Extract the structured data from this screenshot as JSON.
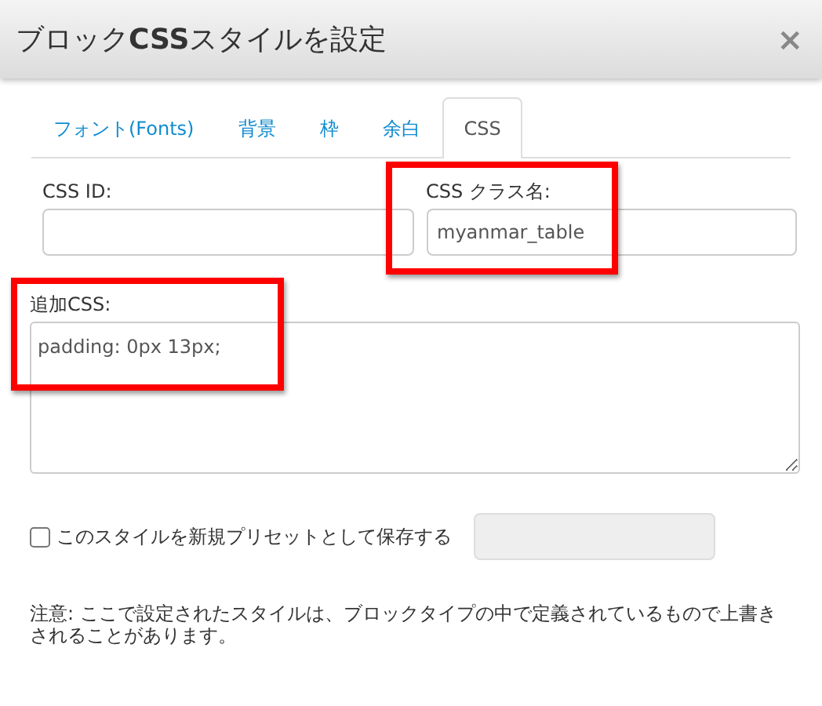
{
  "dialog": {
    "title": "ブロック**CSS**スタイルを設定",
    "close": "×"
  },
  "tabs": [
    {
      "label": "フォント(Fonts)",
      "selected": false
    },
    {
      "label": "背景",
      "selected": false
    },
    {
      "label": "枠",
      "selected": false
    },
    {
      "label": "余白",
      "selected": false
    },
    {
      "label": "CSS",
      "selected": true
    }
  ],
  "fields": [
    {
      "label": "CSS ID:",
      "highlighted": false
    },
    {
      "label": "CSS クラス名:",
      "value": "myanmar_table",
      "highlighted": true
    }
  ],
  "additional_css": {
    "label": "追加CSS:",
    "value": "padding: 0px 13px;",
    "highlighted": true
  },
  "preset": {
    "label": "このスタイルを新規プリセットとして保存する",
    "checked": false,
    "disabled": true
  },
  "note": "注意: ここで設定されたスタイルは、ブロックタイプの中で定義されているもので上書きされることがあります。"
}
